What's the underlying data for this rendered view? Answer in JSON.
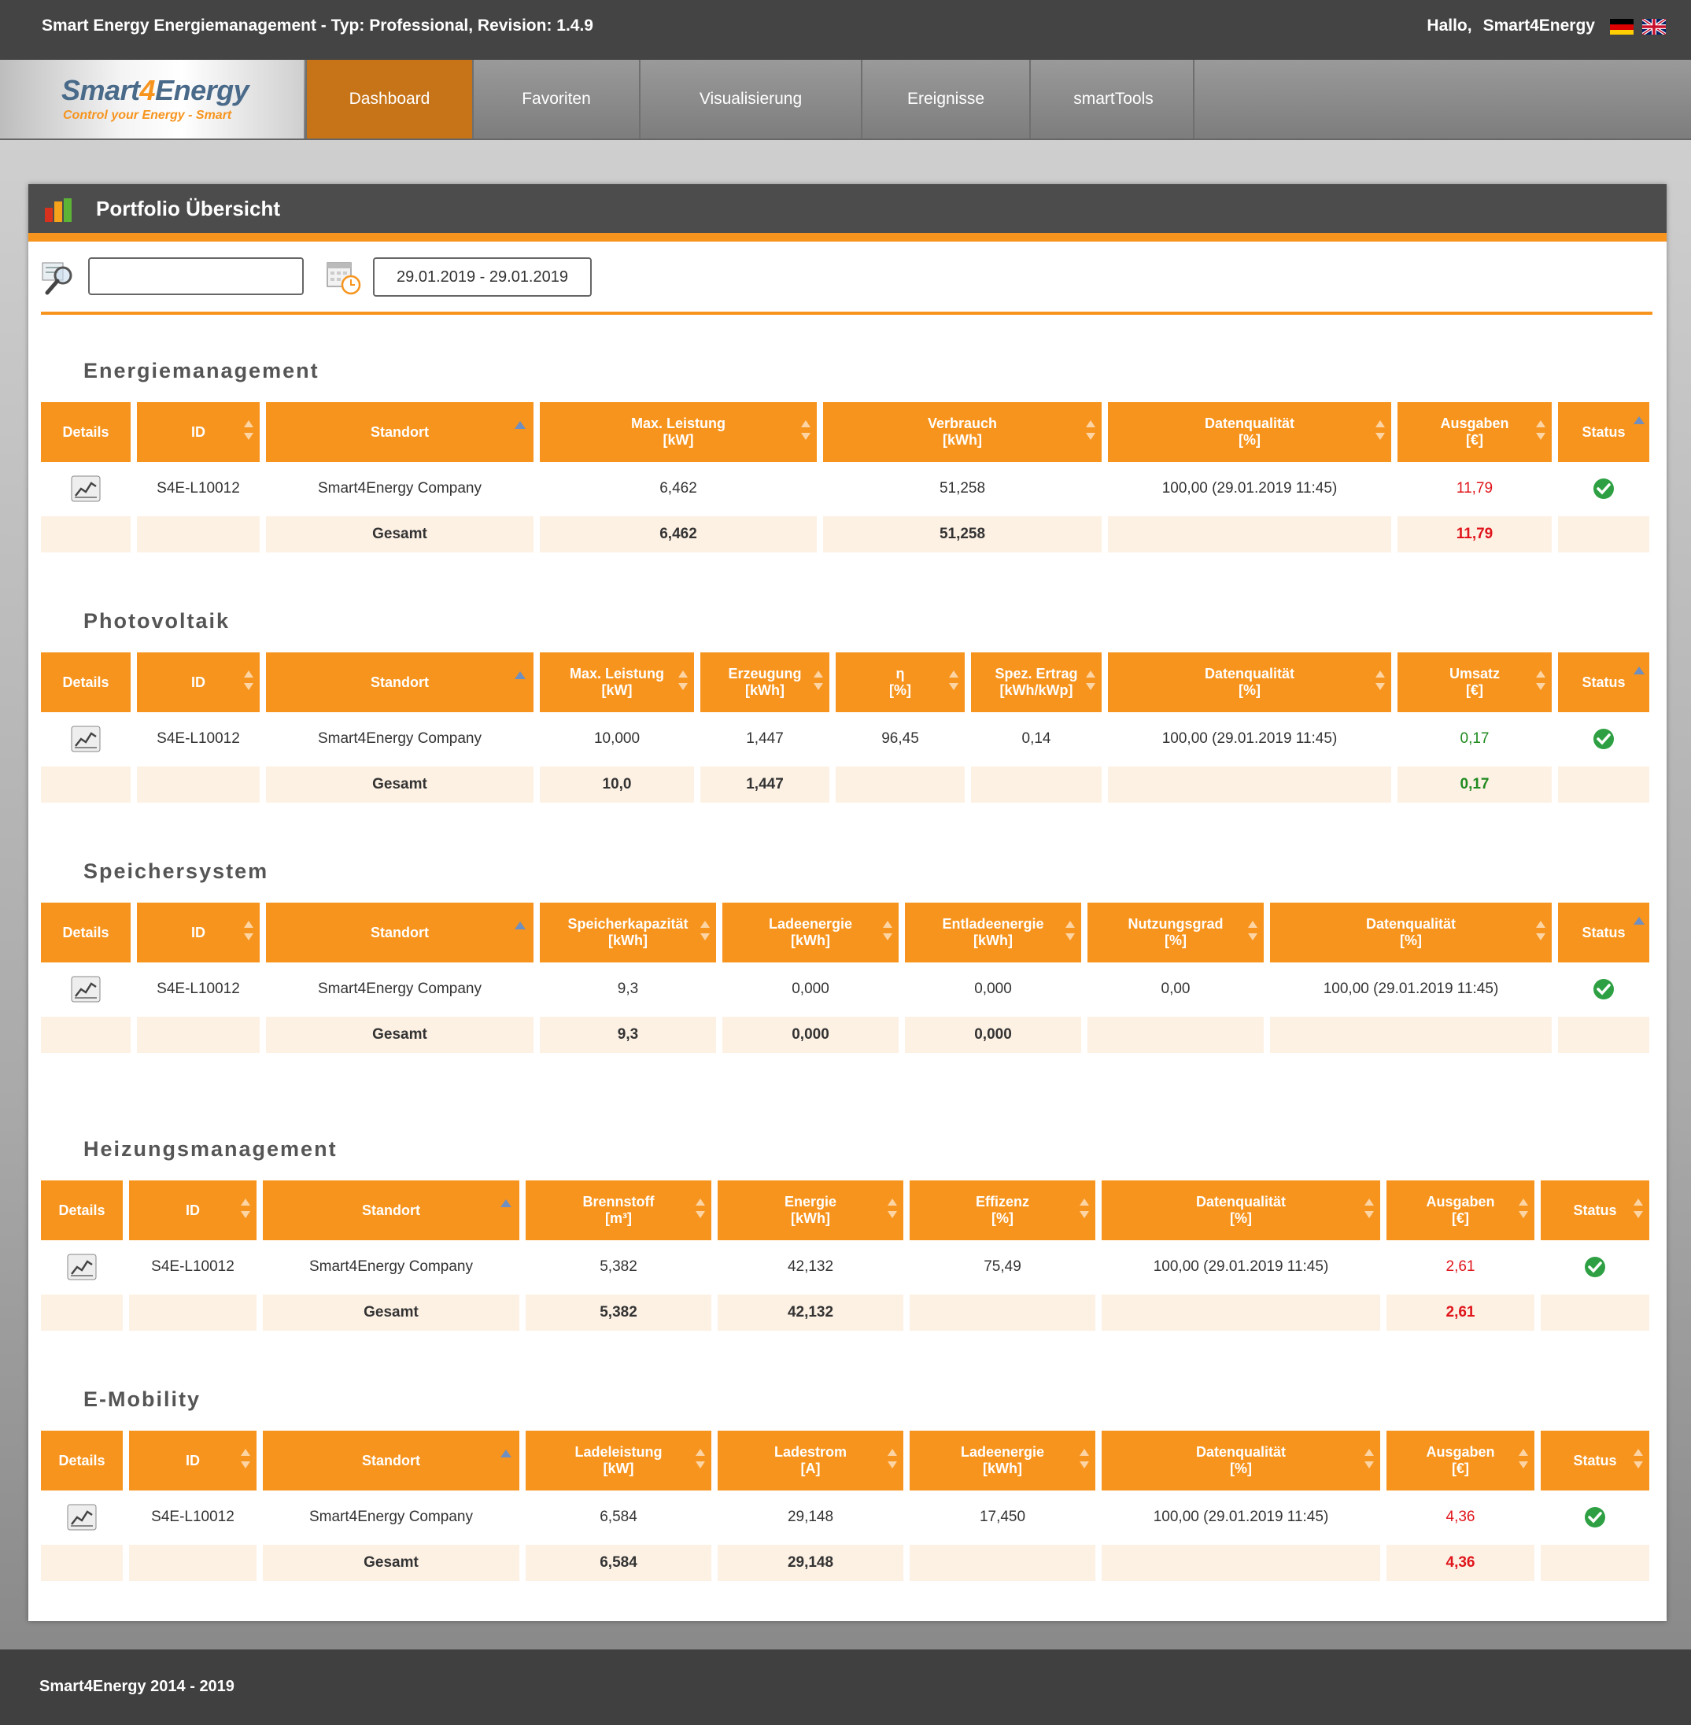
{
  "header": {
    "app_title": "Smart Energy Energiemanagement - Typ: Professional, Revision: 1.4.9",
    "greeting": "Hallo,",
    "user": "Smart4Energy"
  },
  "logo": {
    "brand_pre": "Smart",
    "brand_num": "4",
    "brand_post": "Energy",
    "tagline": "Control your Energy - Smart"
  },
  "nav": {
    "dashboard": "Dashboard",
    "favoriten": "Favoriten",
    "visualisierung": "Visualisierung",
    "ereignisse": "Ereignisse",
    "smarttools": "smartTools"
  },
  "panel": {
    "title": "Portfolio Übersicht",
    "search_value": "",
    "date_range": "29.01.2019 - 29.01.2019"
  },
  "colors": {
    "accent": "#f7941d",
    "header_bg": "#444444",
    "total_bg": "#fdf1e4",
    "expense": "#e0151b",
    "revenue": "#1f8a1f"
  },
  "sections": {
    "energie": {
      "title": "Energiemanagement",
      "headers": [
        "Details",
        "ID",
        "Standort",
        "Max. Leistung\n[kW]",
        "Verbrauch\n[kWh]",
        "Datenqualität\n[%]",
        "Ausgaben\n[€]",
        "Status"
      ],
      "row": {
        "id": "S4E-L10012",
        "standort": "Smart4Energy Company",
        "max_leistung": "6,462",
        "verbrauch": "51,258",
        "datenqualitaet": "100,00 (29.01.2019 11:45)",
        "ausgaben": "11,79"
      },
      "total": {
        "label": "Gesamt",
        "max_leistung": "6,462",
        "verbrauch": "51,258",
        "ausgaben": "11,79"
      }
    },
    "pv": {
      "title": "Photovoltaik",
      "headers": [
        "Details",
        "ID",
        "Standort",
        "Max. Leistung\n[kW]",
        "Erzeugung\n[kWh]",
        "η\n[%]",
        "Spez. Ertrag\n[kWh/kWp]",
        "Datenqualität\n[%]",
        "Umsatz\n[€]",
        "Status"
      ],
      "row": {
        "id": "S4E-L10012",
        "standort": "Smart4Energy Company",
        "max_leistung": "10,000",
        "erzeugung": "1,447",
        "eta": "96,45",
        "spez_ertrag": "0,14",
        "datenqualitaet": "100,00 (29.01.2019 11:45)",
        "umsatz": "0,17"
      },
      "total": {
        "label": "Gesamt",
        "max_leistung": "10,0",
        "erzeugung": "1,447",
        "umsatz": "0,17"
      }
    },
    "speicher": {
      "title": "Speichersystem",
      "headers": [
        "Details",
        "ID",
        "Standort",
        "Speicherkapazität\n[kWh]",
        "Ladeenergie\n[kWh]",
        "Entladeenergie\n[kWh]",
        "Nutzungsgrad\n[%]",
        "Datenqualität\n[%]",
        "Status"
      ],
      "row": {
        "id": "S4E-L10012",
        "standort": "Smart4Energy Company",
        "kapazitaet": "9,3",
        "ladeenergie": "0,000",
        "entladeenergie": "0,000",
        "nutzungsgrad": "0,00",
        "datenqualitaet": "100,00 (29.01.2019 11:45)"
      },
      "total": {
        "label": "Gesamt",
        "kapazitaet": "9,3",
        "ladeenergie": "0,000",
        "entladeenergie": "0,000"
      }
    },
    "heizung": {
      "title": "Heizungsmanagement",
      "headers": [
        "Details",
        "ID",
        "Standort",
        "Brennstoff\n[m³]",
        "Energie\n[kWh]",
        "Effizenz\n[%]",
        "Datenqualität\n[%]",
        "Ausgaben\n[€]",
        "Status"
      ],
      "row": {
        "id": "S4E-L10012",
        "standort": "Smart4Energy Company",
        "brennstoff": "5,382",
        "energie": "42,132",
        "effizienz": "75,49",
        "datenqualitaet": "100,00 (29.01.2019 11:45)",
        "ausgaben": "2,61"
      },
      "total": {
        "label": "Gesamt",
        "brennstoff": "5,382",
        "energie": "42,132",
        "ausgaben": "2,61"
      }
    },
    "emob": {
      "title": "E-Mobility",
      "headers": [
        "Details",
        "ID",
        "Standort",
        "Ladeleistung\n[kW]",
        "Ladestrom\n[A]",
        "Ladeenergie\n[kWh]",
        "Datenqualität\n[%]",
        "Ausgaben\n[€]",
        "Status"
      ],
      "row": {
        "id": "S4E-L10012",
        "standort": "Smart4Energy Company",
        "ladeleistung": "6,584",
        "ladestrom": "29,148",
        "ladeenergie": "17,450",
        "datenqualitaet": "100,00 (29.01.2019 11:45)",
        "ausgaben": "4,36"
      },
      "total": {
        "label": "Gesamt",
        "ladeleistung": "6,584",
        "ladestrom": "29,148",
        "ausgaben": "4,36"
      }
    }
  },
  "footer": {
    "text": "Smart4Energy 2014 - 2019"
  }
}
